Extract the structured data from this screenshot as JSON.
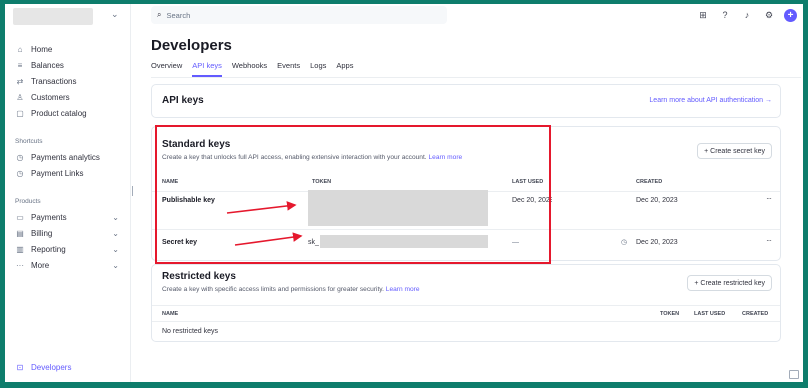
{
  "sidebar": {
    "nav": [
      {
        "label": "Home",
        "icon": "home-icon"
      },
      {
        "label": "Balances",
        "icon": "balances-icon"
      },
      {
        "label": "Transactions",
        "icon": "transactions-icon"
      },
      {
        "label": "Customers",
        "icon": "customers-icon"
      },
      {
        "label": "Product catalog",
        "icon": "catalog-icon"
      }
    ],
    "shortcuts_label": "Shortcuts",
    "shortcuts": [
      {
        "label": "Payments analytics",
        "icon": "clock-icon"
      },
      {
        "label": "Payment Links",
        "icon": "clock-icon"
      }
    ],
    "products_label": "Products",
    "products": [
      {
        "label": "Payments",
        "icon": "payments-icon"
      },
      {
        "label": "Billing",
        "icon": "billing-icon"
      },
      {
        "label": "Reporting",
        "icon": "reporting-icon"
      },
      {
        "label": "More",
        "icon": "more-icon"
      }
    ],
    "developers_label": "Developers"
  },
  "search": {
    "placeholder": "Search"
  },
  "header": {
    "title": "Developers",
    "tabs": [
      "Overview",
      "API keys",
      "Webhooks",
      "Events",
      "Logs",
      "Apps"
    ],
    "active_tab": "API keys"
  },
  "api_card": {
    "title": "API keys",
    "link": "Learn more about API authentication →"
  },
  "standard": {
    "title": "Standard keys",
    "desc": "Create a key that unlocks full API access, enabling extensive interaction with your account.",
    "learn_more": "Learn more",
    "create_button": "+ Create secret key",
    "columns": [
      "NAME",
      "TOKEN",
      "LAST USED",
      "CREATED"
    ],
    "rows": [
      {
        "name": "Publishable key",
        "token": "",
        "last_used": "Dec 20, 2023",
        "created": "Dec 20, 2023"
      },
      {
        "name": "Secret key",
        "token": "sk_",
        "last_used": "—",
        "created": "Dec 20, 2023"
      }
    ]
  },
  "restricted": {
    "title": "Restricted keys",
    "desc": "Create a key with specific access limits and permissions for greater security.",
    "learn_more": "Learn more",
    "create_button": "+ Create restricted key",
    "columns": [
      "NAME",
      "TOKEN",
      "LAST USED",
      "CREATED"
    ],
    "empty": "No restricted keys"
  },
  "colors": {
    "accent": "#635bff",
    "annotation": "#e5182d",
    "frame": "#0e7d6c"
  }
}
